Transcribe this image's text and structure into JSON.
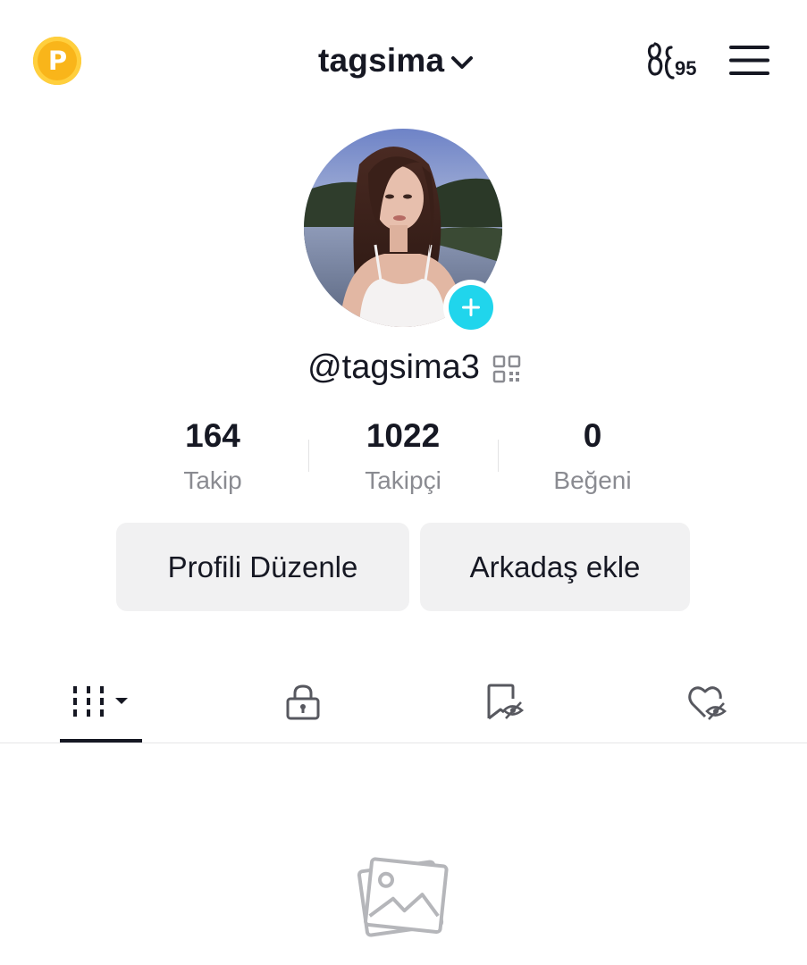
{
  "header": {
    "coin_icon": "p-coin-icon",
    "coin_letter": "P",
    "username": "tagsima",
    "switch_icon": "chevron-down-icon",
    "creator_tools_icon": "creator-tools-icon",
    "creator_count": "95",
    "menu_icon": "hamburger-menu-icon"
  },
  "profile": {
    "avatar": "profile-photo",
    "add_avatar_icon": "plus-icon",
    "handle": "@tagsima3",
    "qr_icon": "qr-code-icon"
  },
  "stats": [
    {
      "value": "164",
      "label": "Takip"
    },
    {
      "value": "1022",
      "label": "Takipçi"
    },
    {
      "value": "0",
      "label": "Beğeni"
    }
  ],
  "buttons": {
    "edit_profile": "Profili Düzenle",
    "add_friend": "Arkadaş ekle"
  },
  "tabs": [
    {
      "icon": "videos-grid-icon",
      "active": true
    },
    {
      "icon": "lock-icon",
      "active": false
    },
    {
      "icon": "hidden-favorites-icon",
      "active": false
    },
    {
      "icon": "hidden-liked-icon",
      "active": false
    }
  ],
  "empty_state": {
    "icon": "photo-placeholder-icon"
  },
  "colors": {
    "text": "#161823",
    "muted": "#8a8b91",
    "accent_cyan": "#20d5ec",
    "coin_gold": "#f9b51a",
    "button_bg": "#f1f1f2"
  }
}
